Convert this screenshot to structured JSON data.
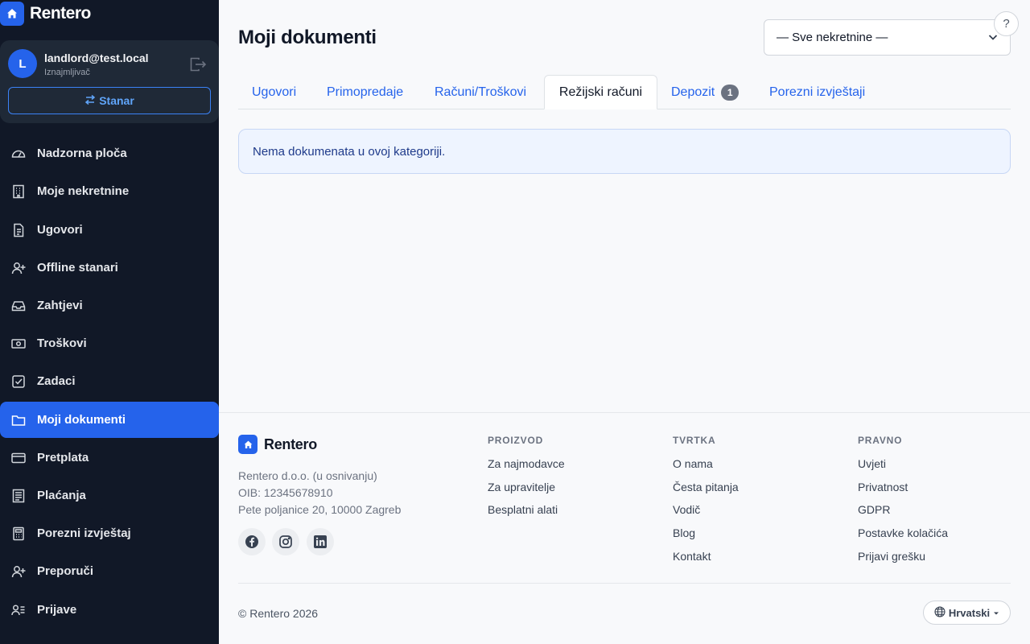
{
  "app": {
    "name": "Rentero"
  },
  "user": {
    "initial": "L",
    "email": "landlord@test.local",
    "role": "Iznajmljivač",
    "switch_label": "Stanar"
  },
  "sidebar": {
    "items": [
      {
        "label": "Nadzorna ploča",
        "icon": "dashboard-icon"
      },
      {
        "label": "Moje nekretnine",
        "icon": "building-icon"
      },
      {
        "label": "Ugovori",
        "icon": "document-icon"
      },
      {
        "label": "Offline stanari",
        "icon": "user-plus-icon"
      },
      {
        "label": "Zahtjevi",
        "icon": "inbox-icon"
      },
      {
        "label": "Troškovi",
        "icon": "cash-icon"
      },
      {
        "label": "Zadaci",
        "icon": "checkbox-icon"
      },
      {
        "label": "Moji dokumenti",
        "icon": "folder-icon",
        "active": true
      },
      {
        "label": "Pretplata",
        "icon": "credit-card-icon"
      },
      {
        "label": "Plaćanja",
        "icon": "receipt-icon"
      },
      {
        "label": "Porezni izvještaj",
        "icon": "calculator-icon"
      },
      {
        "label": "Preporuči",
        "icon": "user-plus-icon"
      },
      {
        "label": "Prijave",
        "icon": "person-lines-icon"
      }
    ]
  },
  "main": {
    "title": "Moji dokumenti",
    "property_select": {
      "value": "— Sve nekretnine —"
    },
    "help_label": "?",
    "tabs": [
      {
        "label": "Ugovori"
      },
      {
        "label": "Primopredaje"
      },
      {
        "label": "Računi/Troškovi"
      },
      {
        "label": "Režijski računi",
        "active": true
      },
      {
        "label": "Depozit",
        "badge": "1"
      },
      {
        "label": "Porezni izvještaji"
      }
    ],
    "empty_message": "Nema dokumenata u ovoj kategoriji."
  },
  "footer": {
    "brand": "Rentero",
    "company": [
      "Rentero d.o.o. (u osnivanju)",
      "OIB: 12345678910",
      "Pete poljanice 20, 10000 Zagreb"
    ],
    "social": [
      "facebook-icon",
      "instagram-icon",
      "linkedin-icon"
    ],
    "columns": [
      {
        "title": "PROIZVOD",
        "links": [
          "Za najmodavce",
          "Za upravitelje",
          "Besplatni alati"
        ]
      },
      {
        "title": "TVRTKA",
        "links": [
          "O nama",
          "Česta pitanja",
          "Vodič",
          "Blog",
          "Kontakt"
        ]
      },
      {
        "title": "PRAVNO",
        "links": [
          "Uvjeti",
          "Privatnost",
          "GDPR",
          "Postavke kolačića",
          "Prijavi grešku"
        ]
      }
    ],
    "copyright": "© Rentero 2026",
    "language": "Hrvatski"
  },
  "colors": {
    "accent": "#2563eb",
    "sidebar_bg": "#111827"
  }
}
